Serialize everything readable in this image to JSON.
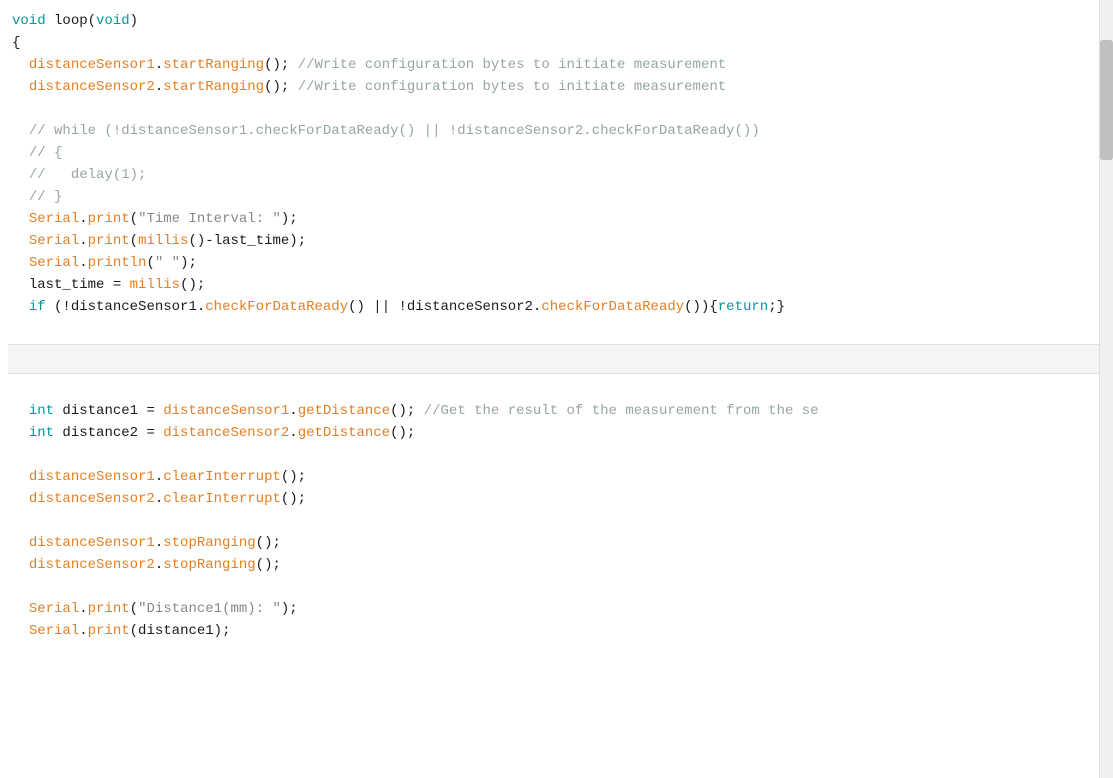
{
  "editor": {
    "background": "#ffffff",
    "lines": [
      {
        "type": "code",
        "tokens": [
          {
            "t": "keyword",
            "v": "void"
          },
          {
            "t": "default",
            "v": " loop("
          },
          {
            "t": "keyword",
            "v": "void"
          },
          {
            "t": "default",
            "v": ")"
          }
        ]
      },
      {
        "type": "code",
        "tokens": [
          {
            "t": "default",
            "v": "{"
          }
        ]
      },
      {
        "type": "code",
        "indent": 1,
        "tokens": [
          {
            "t": "object",
            "v": "distanceSensor1"
          },
          {
            "t": "default",
            "v": "."
          },
          {
            "t": "function",
            "v": "startRanging"
          },
          {
            "t": "default",
            "v": "(); "
          },
          {
            "t": "comment",
            "v": "//Write configuration bytes to initiate measurement"
          }
        ]
      },
      {
        "type": "code",
        "indent": 1,
        "tokens": [
          {
            "t": "object",
            "v": "distanceSensor2"
          },
          {
            "t": "default",
            "v": "."
          },
          {
            "t": "function",
            "v": "startRanging"
          },
          {
            "t": "default",
            "v": "(); "
          },
          {
            "t": "comment",
            "v": "//Write configuration bytes to initiate measurement"
          }
        ]
      },
      {
        "type": "blank"
      },
      {
        "type": "code",
        "indent": 1,
        "tokens": [
          {
            "t": "comment",
            "v": "// while (!distanceSensor1.checkForDataReady() || !distanceSensor2.checkForDataReady())"
          }
        ]
      },
      {
        "type": "code",
        "indent": 1,
        "tokens": [
          {
            "t": "comment",
            "v": "// {"
          }
        ]
      },
      {
        "type": "code",
        "indent": 1,
        "tokens": [
          {
            "t": "comment",
            "v": "//   delay(1);"
          }
        ]
      },
      {
        "type": "code",
        "indent": 1,
        "tokens": [
          {
            "t": "comment",
            "v": "// }"
          }
        ]
      },
      {
        "type": "code",
        "indent": 1,
        "tokens": [
          {
            "t": "object",
            "v": "Serial"
          },
          {
            "t": "default",
            "v": "."
          },
          {
            "t": "function",
            "v": "print"
          },
          {
            "t": "default",
            "v": "("
          },
          {
            "t": "string",
            "v": "\"Time Interval: \""
          },
          {
            "t": "default",
            "v": ");"
          }
        ]
      },
      {
        "type": "code",
        "indent": 1,
        "tokens": [
          {
            "t": "object",
            "v": "Serial"
          },
          {
            "t": "default",
            "v": "."
          },
          {
            "t": "function",
            "v": "print"
          },
          {
            "t": "default",
            "v": "("
          },
          {
            "t": "function",
            "v": "millis"
          },
          {
            "t": "default",
            "v": "()-last_time);"
          }
        ]
      },
      {
        "type": "code",
        "indent": 1,
        "tokens": [
          {
            "t": "object",
            "v": "Serial"
          },
          {
            "t": "default",
            "v": "."
          },
          {
            "t": "function",
            "v": "println"
          },
          {
            "t": "default",
            "v": "("
          },
          {
            "t": "string",
            "v": "\" \""
          },
          {
            "t": "default",
            "v": ");"
          }
        ]
      },
      {
        "type": "code",
        "indent": 1,
        "tokens": [
          {
            "t": "default",
            "v": "last_time = "
          },
          {
            "t": "function",
            "v": "millis"
          },
          {
            "t": "default",
            "v": "();"
          }
        ]
      },
      {
        "type": "code",
        "indent": 1,
        "tokens": [
          {
            "t": "keyword",
            "v": "if"
          },
          {
            "t": "default",
            "v": " (!distanceSensor1."
          },
          {
            "t": "function",
            "v": "checkForDataReady"
          },
          {
            "t": "default",
            "v": "() || !distanceSensor2."
          },
          {
            "t": "function",
            "v": "checkForDataReady"
          },
          {
            "t": "default",
            "v": "()){"
          },
          {
            "t": "keyword",
            "v": "return"
          },
          {
            "t": "default",
            "v": ";}"
          }
        ]
      },
      {
        "type": "blank"
      },
      {
        "type": "separator"
      },
      {
        "type": "blank"
      },
      {
        "type": "code",
        "indent": 1,
        "tokens": [
          {
            "t": "keyword",
            "v": "int"
          },
          {
            "t": "default",
            "v": " distance1 = "
          },
          {
            "t": "object",
            "v": "distanceSensor1"
          },
          {
            "t": "default",
            "v": "."
          },
          {
            "t": "function",
            "v": "getDistance"
          },
          {
            "t": "default",
            "v": "(); "
          },
          {
            "t": "comment",
            "v": "//Get the result of the measurement from the se"
          }
        ]
      },
      {
        "type": "code",
        "indent": 1,
        "tokens": [
          {
            "t": "keyword",
            "v": "int"
          },
          {
            "t": "default",
            "v": " distance2 = "
          },
          {
            "t": "object",
            "v": "distanceSensor2"
          },
          {
            "t": "default",
            "v": "."
          },
          {
            "t": "function",
            "v": "getDistance"
          },
          {
            "t": "default",
            "v": "();"
          }
        ]
      },
      {
        "type": "blank"
      },
      {
        "type": "code",
        "indent": 1,
        "tokens": [
          {
            "t": "object",
            "v": "distanceSensor1"
          },
          {
            "t": "default",
            "v": "."
          },
          {
            "t": "function",
            "v": "clearInterrupt"
          },
          {
            "t": "default",
            "v": "();"
          }
        ]
      },
      {
        "type": "code",
        "indent": 1,
        "tokens": [
          {
            "t": "object",
            "v": "distanceSensor2"
          },
          {
            "t": "default",
            "v": "."
          },
          {
            "t": "function",
            "v": "clearInterrupt"
          },
          {
            "t": "default",
            "v": "();"
          }
        ]
      },
      {
        "type": "blank"
      },
      {
        "type": "code",
        "indent": 1,
        "tokens": [
          {
            "t": "object",
            "v": "distanceSensor1"
          },
          {
            "t": "default",
            "v": "."
          },
          {
            "t": "function",
            "v": "stopRanging"
          },
          {
            "t": "default",
            "v": "();"
          }
        ]
      },
      {
        "type": "code",
        "indent": 1,
        "tokens": [
          {
            "t": "object",
            "v": "distanceSensor2"
          },
          {
            "t": "default",
            "v": "."
          },
          {
            "t": "function",
            "v": "stopRanging"
          },
          {
            "t": "default",
            "v": "();"
          }
        ]
      },
      {
        "type": "blank"
      },
      {
        "type": "code",
        "indent": 1,
        "tokens": [
          {
            "t": "object",
            "v": "Serial"
          },
          {
            "t": "default",
            "v": "."
          },
          {
            "t": "function",
            "v": "print"
          },
          {
            "t": "default",
            "v": "("
          },
          {
            "t": "string",
            "v": "\"Distance1(mm): \""
          },
          {
            "t": "default",
            "v": ");"
          }
        ]
      },
      {
        "type": "code",
        "indent": 1,
        "tokens": [
          {
            "t": "object",
            "v": "Serial"
          },
          {
            "t": "default",
            "v": "."
          },
          {
            "t": "function",
            "v": "print"
          },
          {
            "t": "default",
            "v": "(distance1);"
          }
        ]
      }
    ]
  }
}
